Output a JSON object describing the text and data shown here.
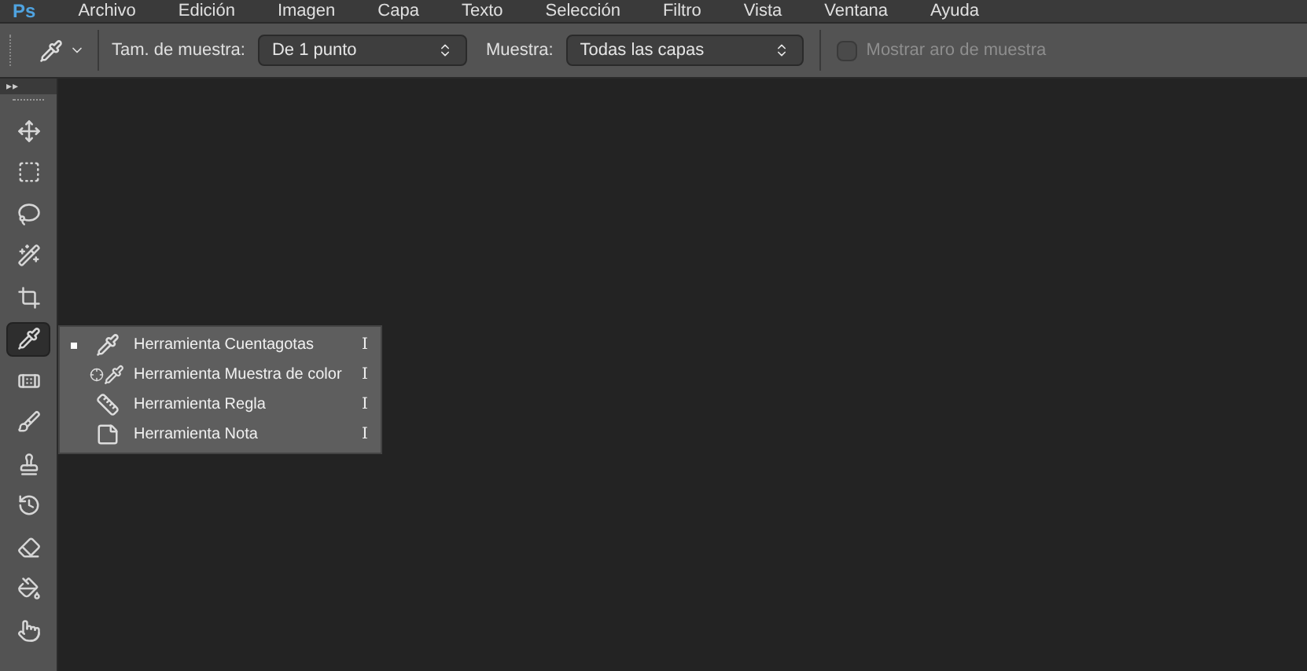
{
  "menu_bar": {
    "logo": "Ps",
    "items": [
      "Archivo",
      "Edición",
      "Imagen",
      "Capa",
      "Texto",
      "Selección",
      "Filtro",
      "Vista",
      "Ventana",
      "Ayuda"
    ]
  },
  "options_bar": {
    "sample_size_label": "Tam. de muestra:",
    "sample_size_value": "De 1 punto",
    "sample_label": "Muestra:",
    "sample_value": "Todas las capas",
    "show_ring": {
      "label": "Mostrar aro de muestra",
      "checked": false,
      "disabled": true
    }
  },
  "toolbar": {
    "expand": "▸▸",
    "tools": [
      {
        "kind": "move",
        "selected": false
      },
      {
        "kind": "marquee",
        "selected": false
      },
      {
        "kind": "lasso",
        "selected": false
      },
      {
        "kind": "wand",
        "selected": false
      },
      {
        "kind": "crop",
        "selected": false
      },
      {
        "kind": "eyedropper",
        "selected": true
      },
      {
        "kind": "heal",
        "selected": false
      },
      {
        "kind": "brush",
        "selected": false
      },
      {
        "kind": "stamp",
        "selected": false
      },
      {
        "kind": "history",
        "selected": false
      },
      {
        "kind": "eraser",
        "selected": false
      },
      {
        "kind": "bucket",
        "selected": false
      },
      {
        "kind": "smudge",
        "selected": false
      }
    ]
  },
  "flyout": [
    {
      "kind": "eyedropper",
      "label": "Herramienta Cuentagotas",
      "shortcut": "I",
      "selected": true
    },
    {
      "kind": "sampler",
      "label": "Herramienta Muestra de color",
      "shortcut": "I",
      "selected": false
    },
    {
      "kind": "ruler",
      "label": "Herramienta Regla",
      "shortcut": "I",
      "selected": false
    },
    {
      "kind": "note",
      "label": "Herramienta Nota",
      "shortcut": "I",
      "selected": false
    }
  ]
}
